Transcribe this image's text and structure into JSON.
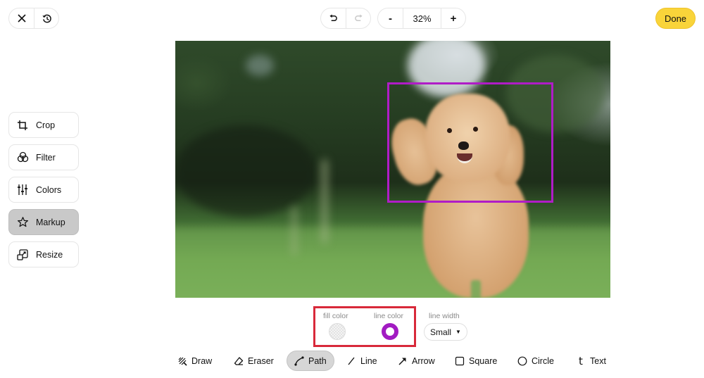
{
  "top_bar": {
    "close_icon": "x-icon",
    "history_icon": "history-icon",
    "undo_icon": "undo-icon",
    "redo_icon": "redo-icon",
    "redo_enabled": false,
    "zoom_out_label": "-",
    "zoom_value": "32%",
    "zoom_in_label": "+",
    "done_label": "Done",
    "done_color": "#f9d43a"
  },
  "sidebar": {
    "items": [
      {
        "label": "Crop",
        "icon": "crop-icon",
        "active": false
      },
      {
        "label": "Filter",
        "icon": "filter-icon",
        "active": false
      },
      {
        "label": "Colors",
        "icon": "sliders-icon",
        "active": false
      },
      {
        "label": "Markup",
        "icon": "star-icon",
        "active": true
      },
      {
        "label": "Resize",
        "icon": "resize-icon",
        "active": false
      }
    ]
  },
  "canvas": {
    "subject": "Apricot poodle running on grass",
    "markup_shape": "rectangle",
    "markup_color": "#b01cc7"
  },
  "options": {
    "fill_color_label": "fill color",
    "fill_color_value": "transparent",
    "line_color_label": "line color",
    "line_color_value": "#a21bc2",
    "line_width_label": "line width",
    "line_width_value": "Small",
    "highlight_color": "#d8293a"
  },
  "tools": [
    {
      "label": "Draw",
      "icon": "draw-icon",
      "active": false
    },
    {
      "label": "Eraser",
      "icon": "eraser-icon",
      "active": false
    },
    {
      "label": "Path",
      "icon": "path-icon",
      "active": true
    },
    {
      "label": "Line",
      "icon": "line-icon",
      "active": false
    },
    {
      "label": "Arrow",
      "icon": "arrow-icon",
      "active": false
    },
    {
      "label": "Square",
      "icon": "square-icon",
      "active": false
    },
    {
      "label": "Circle",
      "icon": "circle-icon",
      "active": false
    },
    {
      "label": "Text",
      "icon": "text-icon",
      "active": false
    }
  ]
}
